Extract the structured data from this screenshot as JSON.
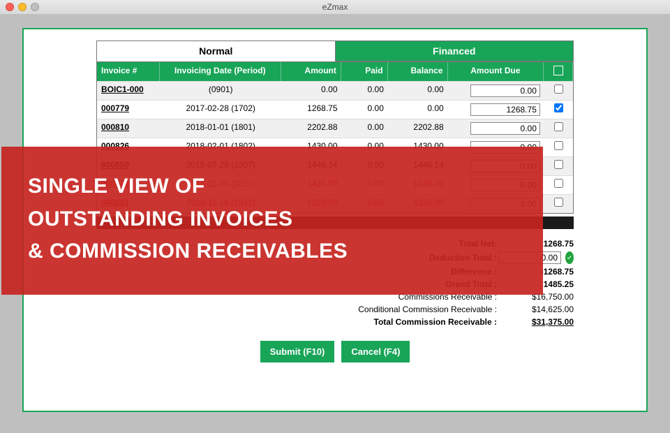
{
  "window": {
    "title": "eZmax"
  },
  "tabs": {
    "normal": "Normal",
    "financed": "Financed"
  },
  "columns": {
    "invoice": "Invoice #",
    "date": "Invoicing Date (Period)",
    "amount": "Amount",
    "paid": "Paid",
    "balance": "Balance",
    "due": "Amount Due"
  },
  "rows": [
    {
      "inv": "BOIC1-000",
      "date": "(0901)",
      "amount": "0.00",
      "paid": "0.00",
      "balance": "0.00",
      "due": "0.00",
      "checked": false,
      "red": false
    },
    {
      "inv": "000779",
      "date": "2017-02-28 (1702)",
      "amount": "1268.75",
      "paid": "0.00",
      "balance": "0.00",
      "due": "1268.75",
      "checked": true,
      "red": false
    },
    {
      "inv": "000810",
      "date": "2018-01-01 (1801)",
      "amount": "2202.88",
      "paid": "0.00",
      "balance": "2202.88",
      "due": "0.00",
      "checked": false,
      "red": false
    },
    {
      "inv": "000826",
      "date": "2018-02-01 (1802)",
      "amount": "1430.00",
      "paid": "0.00",
      "balance": "1430.00",
      "due": "0.00",
      "checked": false,
      "red": false
    },
    {
      "inv": "000850",
      "date": "2018-07-28 (1807)",
      "amount": "1446.14",
      "paid": "0.00",
      "balance": "1446.14",
      "due": "0.00",
      "checked": false,
      "red": false
    },
    {
      "inv": "000879",
      "date": "2018-11-06 (1811)",
      "amount": "1430.00",
      "paid": "0.00",
      "balance": "1430.00",
      "due": "0.00",
      "checked": false,
      "red": true
    },
    {
      "inv": "000881",
      "date": "2018-11-16 (1811)",
      "amount": "1320.00",
      "paid": "0.00",
      "balance": "1320.00",
      "due": "0.00",
      "checked": false,
      "red": true
    }
  ],
  "totals": {
    "net_lbl": "Total Net:",
    "net": "1268.75",
    "ded_lbl": "Deduction Total :",
    "ded": "0.00",
    "diff_lbl": "Difference :",
    "diff": "-1268.75",
    "grand_lbl": "Grand Total :",
    "grand": "1485.25",
    "comm_lbl": "Commissions Receivable :",
    "comm": "$16,750.00",
    "cond_lbl": "Conditional Commission Receivable :",
    "cond": "$14,625.00",
    "tot_lbl": "Total Commission Receivable :",
    "tot": "$31,375.00"
  },
  "buttons": {
    "submit": "Submit (F10)",
    "cancel": "Cancel (F4)"
  },
  "overlay": {
    "l1": "SINGLE VIEW OF",
    "l2": "OUTSTANDING INVOICES",
    "l3": "& COMMISSION RECEIVABLES"
  }
}
